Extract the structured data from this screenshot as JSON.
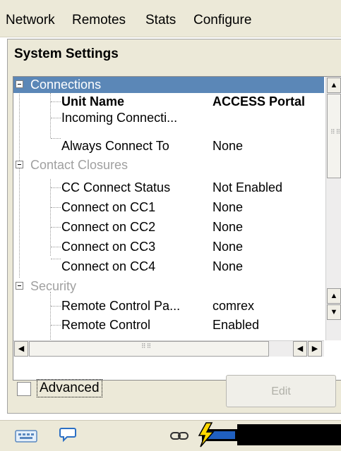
{
  "menu": [
    "Network",
    "Remotes",
    "Stats",
    "Configure"
  ],
  "panel": {
    "title": "System Settings"
  },
  "tree": {
    "connections": {
      "label": "Connections",
      "items": [
        {
          "name": "Unit Name",
          "value": "ACCESS Portal"
        },
        {
          "name": "Incoming Connecti...",
          "value": ""
        },
        {
          "name": "Always Connect To",
          "value": "None"
        }
      ]
    },
    "contact_closures": {
      "label": "Contact Closures",
      "items": [
        {
          "name": "CC Connect Status",
          "value": "Not Enabled"
        },
        {
          "name": "Connect on CC1",
          "value": "None"
        },
        {
          "name": "Connect on CC2",
          "value": "None"
        },
        {
          "name": "Connect on CC3",
          "value": "None"
        },
        {
          "name": "Connect on CC4",
          "value": "None"
        }
      ]
    },
    "security": {
      "label": "Security",
      "items": [
        {
          "name": "Remote Control Pa...",
          "value": "comrex"
        },
        {
          "name": "Remote Control",
          "value": "Enabled"
        }
      ]
    }
  },
  "advanced": {
    "label": "Advanced",
    "checked": false
  },
  "edit_button": {
    "label": "Edit",
    "enabled": false
  },
  "statusbar": {
    "icons": [
      "keyboard-icon",
      "chat-bubble-icon",
      "link-icon",
      "battery-charging-icon"
    ],
    "battery_color": "#2060c0",
    "bolt_color": "#ffd800"
  },
  "colors": {
    "selection": "#5b87b7",
    "background": "#ece9d8"
  }
}
